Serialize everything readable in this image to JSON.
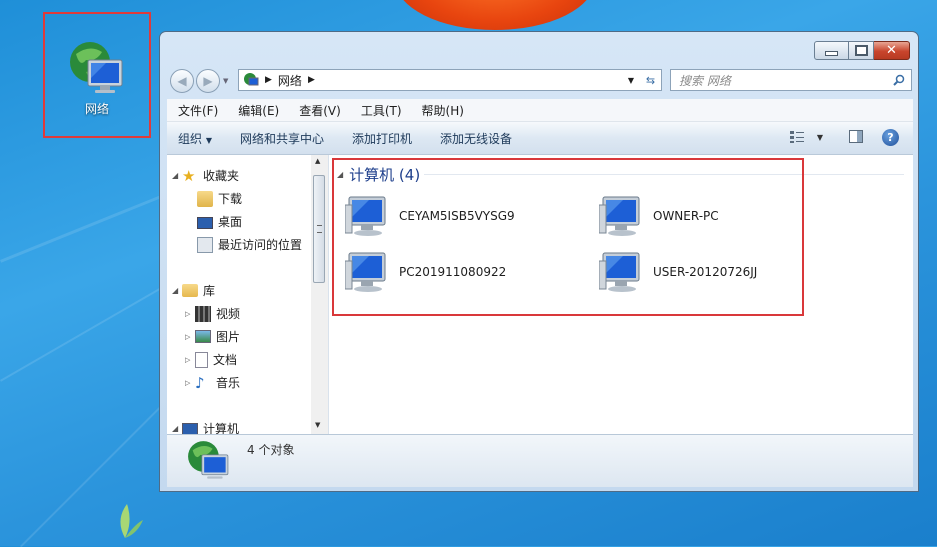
{
  "desktop": {
    "network_icon_label": "网络"
  },
  "window": {
    "address": {
      "segments": [
        "网络"
      ]
    },
    "search_placeholder": "搜索 网络",
    "menu": [
      "文件(F)",
      "编辑(E)",
      "查看(V)",
      "工具(T)",
      "帮助(H)"
    ],
    "commands": [
      "组织",
      "网络和共享中心",
      "添加打印机",
      "添加无线设备"
    ],
    "nav": {
      "favorites": {
        "label": "收藏夹",
        "items": [
          "下载",
          "桌面",
          "最近访问的位置"
        ]
      },
      "libraries": {
        "label": "库",
        "items": [
          "视频",
          "图片",
          "文档",
          "音乐"
        ]
      },
      "computer": {
        "label": "计算机"
      }
    },
    "group": {
      "title": "计算机 (4)"
    },
    "computers": [
      "CEYAM5ISB5VYSG9",
      "OWNER-PC",
      "PC201911080922",
      "USER-20120726JJ"
    ],
    "status": "4 个对象"
  },
  "colors": {
    "highlight_box": "#d9383a",
    "group_title": "#1e3f8c"
  }
}
